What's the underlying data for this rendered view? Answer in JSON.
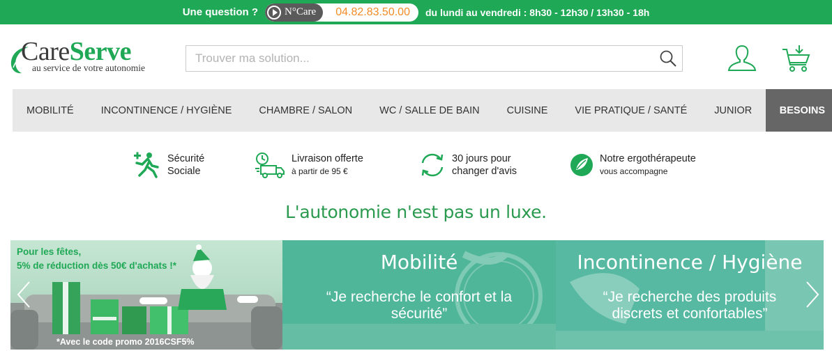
{
  "topbar": {
    "question": "Une question ?",
    "brand": "N°Care",
    "phone": "04.82.83.50.00",
    "hours": "du lundi au vendredi : 8h30 - 12h30 / 13h30 - 18h"
  },
  "logo": {
    "name_part1": "Care",
    "name_part2": "Serve",
    "tagline": "au service de votre autonomie"
  },
  "search": {
    "placeholder": "Trouver ma solution..."
  },
  "nav": {
    "items": [
      "MOBILITÉ",
      "INCONTINENCE / HYGIÈNE",
      "CHAMBRE / SALON",
      "WC / SALLE DE BAIN",
      "CUISINE",
      "VIE PRATIQUE / SANTÉ",
      "JUNIOR"
    ],
    "besoins": "BESOINS"
  },
  "features": [
    {
      "icon": "medical-runner-icon",
      "line1": "Sécurité",
      "line2": "Sociale"
    },
    {
      "icon": "delivery-truck-icon",
      "line1": "Livraison offerte",
      "line2": "à partir de 95 €"
    },
    {
      "icon": "refresh-arrows-icon",
      "line1": "30 jours pour",
      "line2": "changer d'avis"
    },
    {
      "icon": "ergo-leaf-icon",
      "line1": "Notre ergothérapeute",
      "line2": "vous accompagne"
    }
  ],
  "slogan": "L'autonomie n'est pas un luxe.",
  "banners": {
    "promo": {
      "line1": "Pour les fêtes,",
      "line2": "5% de réduction dès 50€ d'achats !*",
      "code": "*Avec le code promo 2016CSF5%"
    },
    "mobilite": {
      "title": "Mobilité",
      "quote": "“Je recherche le confort et la sécurité”"
    },
    "incontinence": {
      "title": "Incontinence / Hygiène",
      "quote": "“Je recherche des produits discrets et confortables”"
    }
  },
  "colors": {
    "brand_green": "#1fa855",
    "phone_orange": "#f28c28",
    "nav_bg": "#e8e8e8",
    "besoins_bg": "#666666"
  }
}
